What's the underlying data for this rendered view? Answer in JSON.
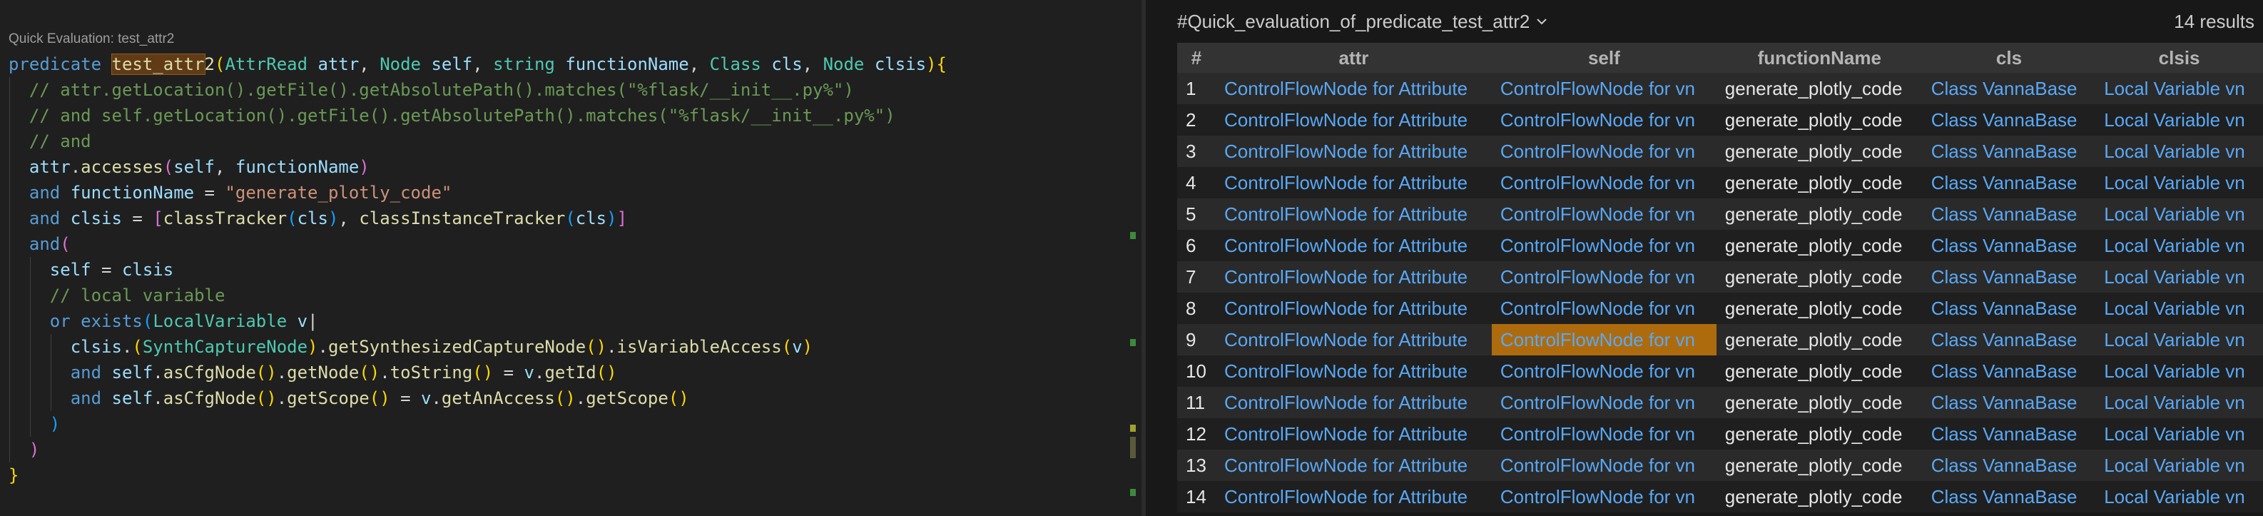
{
  "editor": {
    "codelens": "Quick Evaluation: test_attr2",
    "lines": [
      {
        "indent": 0,
        "tokens": [
          [
            "kw",
            "predicate "
          ],
          [
            "hl",
            "test_attr"
          ],
          [
            "fn",
            "2"
          ],
          [
            "brk1",
            "("
          ],
          [
            "type",
            "AttrRead"
          ],
          [
            "plain",
            " "
          ],
          [
            "var",
            "attr"
          ],
          [
            "plain",
            ", "
          ],
          [
            "type",
            "Node"
          ],
          [
            "plain",
            " "
          ],
          [
            "var",
            "self"
          ],
          [
            "plain",
            ", "
          ],
          [
            "type",
            "string"
          ],
          [
            "plain",
            " "
          ],
          [
            "var",
            "functionName"
          ],
          [
            "plain",
            ", "
          ],
          [
            "type",
            "Class"
          ],
          [
            "plain",
            " "
          ],
          [
            "var",
            "cls"
          ],
          [
            "plain",
            ", "
          ],
          [
            "type",
            "Node"
          ],
          [
            "plain",
            " "
          ],
          [
            "var",
            "clsis"
          ],
          [
            "brk1",
            ")"
          ],
          [
            "brk1",
            "{"
          ]
        ]
      },
      {
        "indent": 1,
        "tokens": [
          [
            "com",
            "// attr.getLocation().getFile().getAbsolutePath().matches(\"%flask/__init__.py%\")"
          ]
        ]
      },
      {
        "indent": 1,
        "tokens": [
          [
            "com",
            "// and self.getLocation().getFile().getAbsolutePath().matches(\"%flask/__init__.py%\")"
          ]
        ]
      },
      {
        "indent": 1,
        "tokens": [
          [
            "com",
            "// and"
          ]
        ]
      },
      {
        "indent": 1,
        "tokens": [
          [
            "var",
            "attr"
          ],
          [
            "plain",
            "."
          ],
          [
            "fn",
            "accesses"
          ],
          [
            "brk2",
            "("
          ],
          [
            "var",
            "self"
          ],
          [
            "plain",
            ", "
          ],
          [
            "var",
            "functionName"
          ],
          [
            "brk2",
            ")"
          ]
        ]
      },
      {
        "indent": 1,
        "tokens": [
          [
            "kw",
            "and "
          ],
          [
            "var",
            "functionName"
          ],
          [
            "plain",
            " = "
          ],
          [
            "str",
            "\"generate_plotly_code\""
          ]
        ]
      },
      {
        "indent": 1,
        "tokens": [
          [
            "kw",
            "and "
          ],
          [
            "var",
            "clsis"
          ],
          [
            "plain",
            " = "
          ],
          [
            "brk2",
            "["
          ],
          [
            "fn",
            "classTracker"
          ],
          [
            "brk3",
            "("
          ],
          [
            "var",
            "cls"
          ],
          [
            "brk3",
            ")"
          ],
          [
            "plain",
            ", "
          ],
          [
            "fn",
            "classInstanceTracker"
          ],
          [
            "brk3",
            "("
          ],
          [
            "var",
            "cls"
          ],
          [
            "brk3",
            ")"
          ],
          [
            "brk2",
            "]"
          ]
        ]
      },
      {
        "indent": 1,
        "tokens": [
          [
            "kw",
            "and"
          ],
          [
            "brk2",
            "("
          ]
        ]
      },
      {
        "indent": 2,
        "tokens": [
          [
            "var",
            "self"
          ],
          [
            "plain",
            " = "
          ],
          [
            "var",
            "clsis"
          ]
        ]
      },
      {
        "indent": 2,
        "tokens": [
          [
            "com",
            "// local variable"
          ]
        ]
      },
      {
        "indent": 2,
        "tokens": [
          [
            "kw",
            "or "
          ],
          [
            "kw",
            "exists"
          ],
          [
            "brk3",
            "("
          ],
          [
            "type",
            "LocalVariable"
          ],
          [
            "plain",
            " "
          ],
          [
            "var",
            "v"
          ],
          [
            "plain",
            "|"
          ]
        ]
      },
      {
        "indent": 3,
        "tokens": [
          [
            "var",
            "clsis"
          ],
          [
            "plain",
            "."
          ],
          [
            "brk1",
            "("
          ],
          [
            "type",
            "SynthCaptureNode"
          ],
          [
            "brk1",
            ")"
          ],
          [
            "plain",
            "."
          ],
          [
            "fn",
            "getSynthesizedCaptureNode"
          ],
          [
            "brk1",
            "()"
          ],
          [
            "plain",
            "."
          ],
          [
            "fn",
            "isVariableAccess"
          ],
          [
            "brk1",
            "("
          ],
          [
            "var",
            "v"
          ],
          [
            "brk1",
            ")"
          ]
        ]
      },
      {
        "indent": 3,
        "tokens": [
          [
            "kw",
            "and "
          ],
          [
            "var",
            "self"
          ],
          [
            "plain",
            "."
          ],
          [
            "fn",
            "asCfgNode"
          ],
          [
            "brk1",
            "()"
          ],
          [
            "plain",
            "."
          ],
          [
            "fn",
            "getNode"
          ],
          [
            "brk1",
            "()"
          ],
          [
            "plain",
            "."
          ],
          [
            "fn",
            "toString"
          ],
          [
            "brk1",
            "()"
          ],
          [
            "plain",
            " = "
          ],
          [
            "var",
            "v"
          ],
          [
            "plain",
            "."
          ],
          [
            "fn",
            "getId"
          ],
          [
            "brk1",
            "()"
          ]
        ]
      },
      {
        "indent": 3,
        "tokens": [
          [
            "kw",
            "and "
          ],
          [
            "var",
            "self"
          ],
          [
            "plain",
            "."
          ],
          [
            "fn",
            "asCfgNode"
          ],
          [
            "brk1",
            "()"
          ],
          [
            "plain",
            "."
          ],
          [
            "fn",
            "getScope"
          ],
          [
            "brk1",
            "()"
          ],
          [
            "plain",
            " = "
          ],
          [
            "var",
            "v"
          ],
          [
            "plain",
            "."
          ],
          [
            "fn",
            "getAnAccess"
          ],
          [
            "brk1",
            "()"
          ],
          [
            "plain",
            "."
          ],
          [
            "fn",
            "getScope"
          ],
          [
            "brk1",
            "()"
          ]
        ]
      },
      {
        "indent": 2,
        "tokens": [
          [
            "brk3",
            ")"
          ]
        ]
      },
      {
        "indent": 1,
        "tokens": [
          [
            "brk2",
            ")"
          ]
        ]
      },
      {
        "indent": 0,
        "tokens": [
          [
            "brk1",
            "}"
          ]
        ]
      }
    ]
  },
  "results": {
    "selector": "#Quick_evaluation_of_predicate_test_attr2",
    "count": "14 results",
    "columns": [
      "#",
      "attr",
      "self",
      "functionName",
      "cls",
      "clsis"
    ],
    "rows": [
      [
        "1",
        "ControlFlowNode for Attribute",
        "ControlFlowNode for vn",
        "generate_plotly_code",
        "Class VannaBase",
        "Local Variable vn"
      ],
      [
        "2",
        "ControlFlowNode for Attribute",
        "ControlFlowNode for vn",
        "generate_plotly_code",
        "Class VannaBase",
        "Local Variable vn"
      ],
      [
        "3",
        "ControlFlowNode for Attribute",
        "ControlFlowNode for vn",
        "generate_plotly_code",
        "Class VannaBase",
        "Local Variable vn"
      ],
      [
        "4",
        "ControlFlowNode for Attribute",
        "ControlFlowNode for vn",
        "generate_plotly_code",
        "Class VannaBase",
        "Local Variable vn"
      ],
      [
        "5",
        "ControlFlowNode for Attribute",
        "ControlFlowNode for vn",
        "generate_plotly_code",
        "Class VannaBase",
        "Local Variable vn"
      ],
      [
        "6",
        "ControlFlowNode for Attribute",
        "ControlFlowNode for vn",
        "generate_plotly_code",
        "Class VannaBase",
        "Local Variable vn"
      ],
      [
        "7",
        "ControlFlowNode for Attribute",
        "ControlFlowNode for vn",
        "generate_plotly_code",
        "Class VannaBase",
        "Local Variable vn"
      ],
      [
        "8",
        "ControlFlowNode for Attribute",
        "ControlFlowNode for vn",
        "generate_plotly_code",
        "Class VannaBase",
        "Local Variable vn"
      ],
      [
        "9",
        "ControlFlowNode for Attribute",
        "ControlFlowNode for vn",
        "generate_plotly_code",
        "Class VannaBase",
        "Local Variable vn"
      ],
      [
        "10",
        "ControlFlowNode for Attribute",
        "ControlFlowNode for vn",
        "generate_plotly_code",
        "Class VannaBase",
        "Local Variable vn"
      ],
      [
        "11",
        "ControlFlowNode for Attribute",
        "ControlFlowNode for vn",
        "generate_plotly_code",
        "Class VannaBase",
        "Local Variable vn"
      ],
      [
        "12",
        "ControlFlowNode for Attribute",
        "ControlFlowNode for vn",
        "generate_plotly_code",
        "Class VannaBase",
        "Local Variable vn"
      ],
      [
        "13",
        "ControlFlowNode for Attribute",
        "ControlFlowNode for vn",
        "generate_plotly_code",
        "Class VannaBase",
        "Local Variable vn"
      ],
      [
        "14",
        "ControlFlowNode for Attribute",
        "ControlFlowNode for vn",
        "generate_plotly_code",
        "Class VannaBase",
        "Local Variable vn"
      ]
    ],
    "selected_row": 9,
    "selected_col": 2
  }
}
